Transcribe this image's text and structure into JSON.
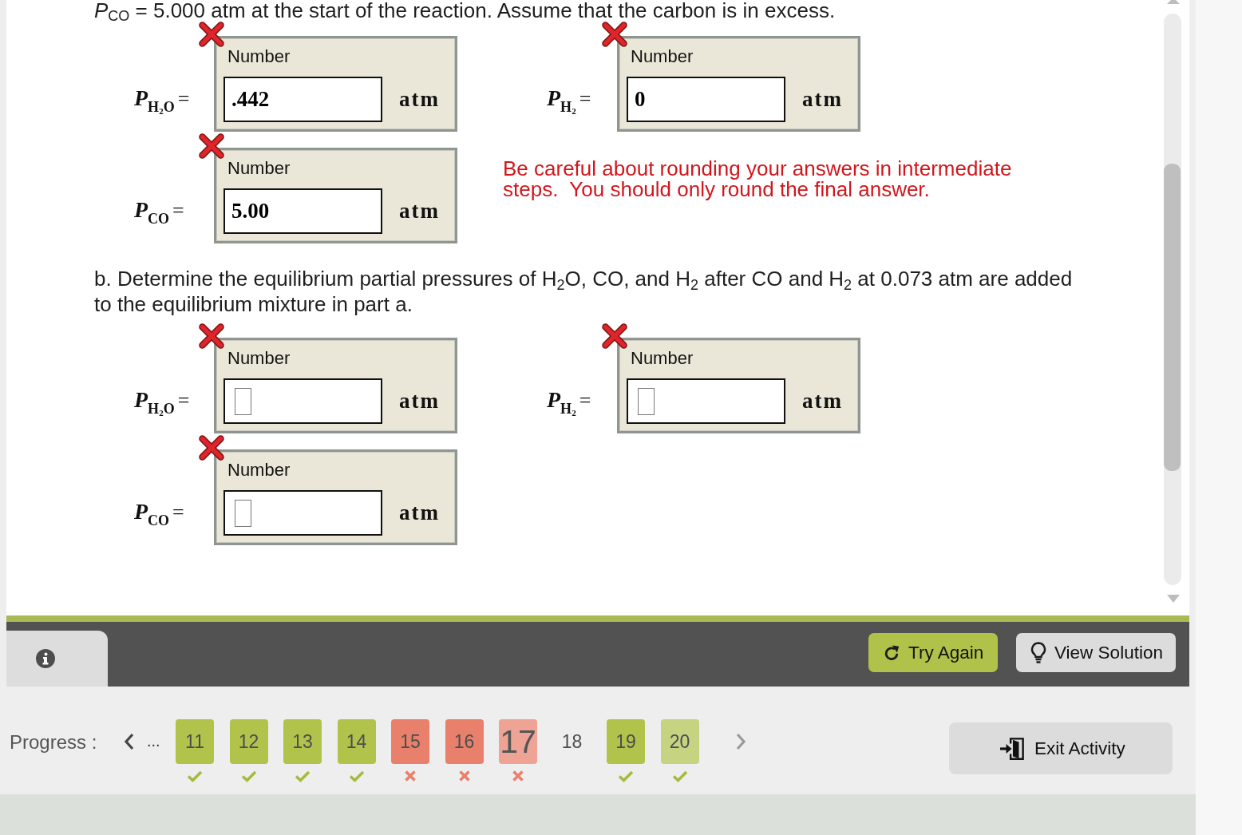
{
  "question": {
    "intro_tail": "*P*$_{CO}$ = 5.000 atm at the start of the reaction. Assume that the carbon is in excess.",
    "part_a": {
      "answers": [
        {
          "variable": "P",
          "subscript": "$_{H}$$_{2}$$_{O}$",
          "relation": "=",
          "field_label": "Number",
          "value": ".442",
          "unit": "atm",
          "incorrect": true
        },
        {
          "variable": "P",
          "subscript": "$_{H}$$_{2}$",
          "relation": "=",
          "field_label": "Number",
          "value": "0",
          "unit": "atm",
          "incorrect": true
        },
        {
          "variable": "P",
          "subscript": "$_{CO}$",
          "relation": "=",
          "field_label": "Number",
          "value": "5.00",
          "unit": "atm",
          "incorrect": true
        }
      ],
      "note": "Be careful about rounding your answers in intermediate steps.  You should only round the final answer."
    },
    "part_b": {
      "prompt": "b. Determine the equilibrium partial pressures of H$_{2}$O, CO, and H$_{2}$ after CO and H$_{2}$ at 0.073 atm are added to the equilibrium mixture in part a.",
      "answers": [
        {
          "variable": "P",
          "subscript": "$_{H}$$_{2}$$_{O}$",
          "relation": "=",
          "field_label": "Number",
          "unit": "atm",
          "incorrect": true
        },
        {
          "variable": "P",
          "subscript": "$_{H}$$_{2}$",
          "relation": "=",
          "field_label": "Number",
          "unit": "atm",
          "incorrect": true
        },
        {
          "variable": "P",
          "subscript": "$_{CO}$",
          "relation": "=",
          "field_label": "Number",
          "unit": "atm",
          "incorrect": true
        }
      ]
    }
  },
  "footer_bar": {
    "try_again": "Try Again",
    "view_solution": "View Solution"
  },
  "progress": {
    "label": "Progress :",
    "ellipsis": "...",
    "items": [
      {
        "label": "11",
        "kind": "correct",
        "color": "#b2c34b",
        "selected": false
      },
      {
        "label": "12",
        "kind": "correct",
        "color": "#b2c34b",
        "selected": false
      },
      {
        "label": "13",
        "kind": "correct",
        "color": "#b2c34b",
        "selected": false
      },
      {
        "label": "14",
        "kind": "correct",
        "color": "#b2c34b",
        "selected": false
      },
      {
        "label": "15",
        "kind": "incorrect",
        "color": "#e9806b",
        "selected": false
      },
      {
        "label": "16",
        "kind": "incorrect",
        "color": "#e9806b",
        "selected": false
      },
      {
        "label": "17",
        "kind": "incorrect",
        "color": "#eea394",
        "selected": true
      },
      {
        "label": "18",
        "kind": "unanswered",
        "selected": false
      },
      {
        "label": "19",
        "kind": "correct",
        "color": "#b2c34b",
        "selected": false
      },
      {
        "label": "20",
        "kind": "correct",
        "color": "#c6d381",
        "selected": false
      }
    ]
  },
  "exit_button": "Exit Activity"
}
